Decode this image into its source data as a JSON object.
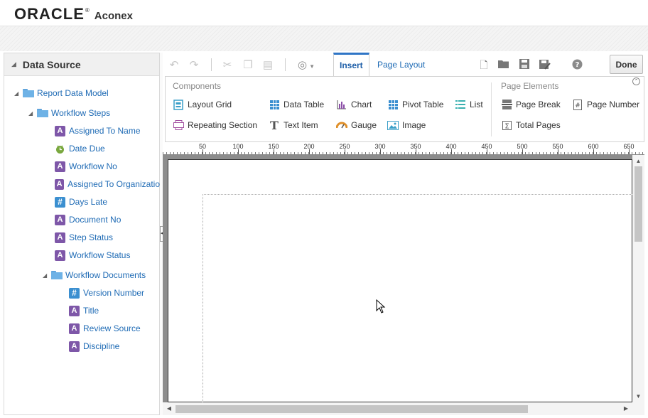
{
  "header": {
    "brand_oracle": "ORACLE",
    "brand_registered": "®",
    "brand_product": "Aconex"
  },
  "data_source": {
    "title": "Data Source",
    "tree": [
      {
        "label": "Report Data Model",
        "type": "folder"
      },
      {
        "label": "Workflow Steps",
        "type": "folder"
      },
      {
        "label": "Assigned To Name",
        "type": "text"
      },
      {
        "label": "Date Due",
        "type": "date"
      },
      {
        "label": "Workflow No",
        "type": "text"
      },
      {
        "label": "Assigned To Organizatio",
        "type": "text"
      },
      {
        "label": "Days Late",
        "type": "number"
      },
      {
        "label": "Document No",
        "type": "text"
      },
      {
        "label": "Step Status",
        "type": "text"
      },
      {
        "label": "Workflow Status",
        "type": "text"
      },
      {
        "label": "Workflow Documents",
        "type": "folder"
      },
      {
        "label": "Version Number",
        "type": "number"
      },
      {
        "label": "Title",
        "type": "text"
      },
      {
        "label": "Review Source",
        "type": "text"
      },
      {
        "label": "Discipline",
        "type": "text"
      }
    ]
  },
  "toolbar": {
    "tabs": [
      {
        "label": "Insert",
        "active": true
      },
      {
        "label": "Page Layout",
        "active": false
      }
    ],
    "done_label": "Done",
    "icons": [
      "undo-icon",
      "redo-icon",
      "cut-icon",
      "copy-icon",
      "paste-icon",
      "data-icon",
      "new-icon",
      "open-icon",
      "save-icon",
      "save-as-icon",
      "help-icon"
    ]
  },
  "ribbon": {
    "components_title": "Components",
    "page_elements_title": "Page Elements",
    "components": [
      {
        "label": "Layout Grid",
        "icon": "layout-grid-icon"
      },
      {
        "label": "Data Table",
        "icon": "data-table-icon"
      },
      {
        "label": "Chart",
        "icon": "chart-icon"
      },
      {
        "label": "Pivot Table",
        "icon": "pivot-table-icon"
      },
      {
        "label": "List",
        "icon": "list-icon"
      },
      {
        "label": "Repeating Section",
        "icon": "repeating-section-icon"
      },
      {
        "label": "Text Item",
        "icon": "text-item-icon"
      },
      {
        "label": "Gauge",
        "icon": "gauge-icon"
      },
      {
        "label": "Image",
        "icon": "image-icon"
      }
    ],
    "page_elements": [
      {
        "label": "Page Break",
        "icon": "page-break-icon"
      },
      {
        "label": "Page Number",
        "icon": "page-number-icon"
      },
      {
        "label": "Total Pages",
        "icon": "total-pages-icon"
      }
    ]
  },
  "ruler": {
    "labels": [
      "50",
      "100",
      "150",
      "200",
      "250",
      "300",
      "350",
      "400",
      "450",
      "500",
      "550",
      "600",
      "650"
    ]
  },
  "colors": {
    "accent": "#2f75c6",
    "link": "#1f6bb5",
    "text_badge": "#7e57a8",
    "number_badge": "#3b8fd0",
    "canvas_gray": "#8c8c8c"
  }
}
